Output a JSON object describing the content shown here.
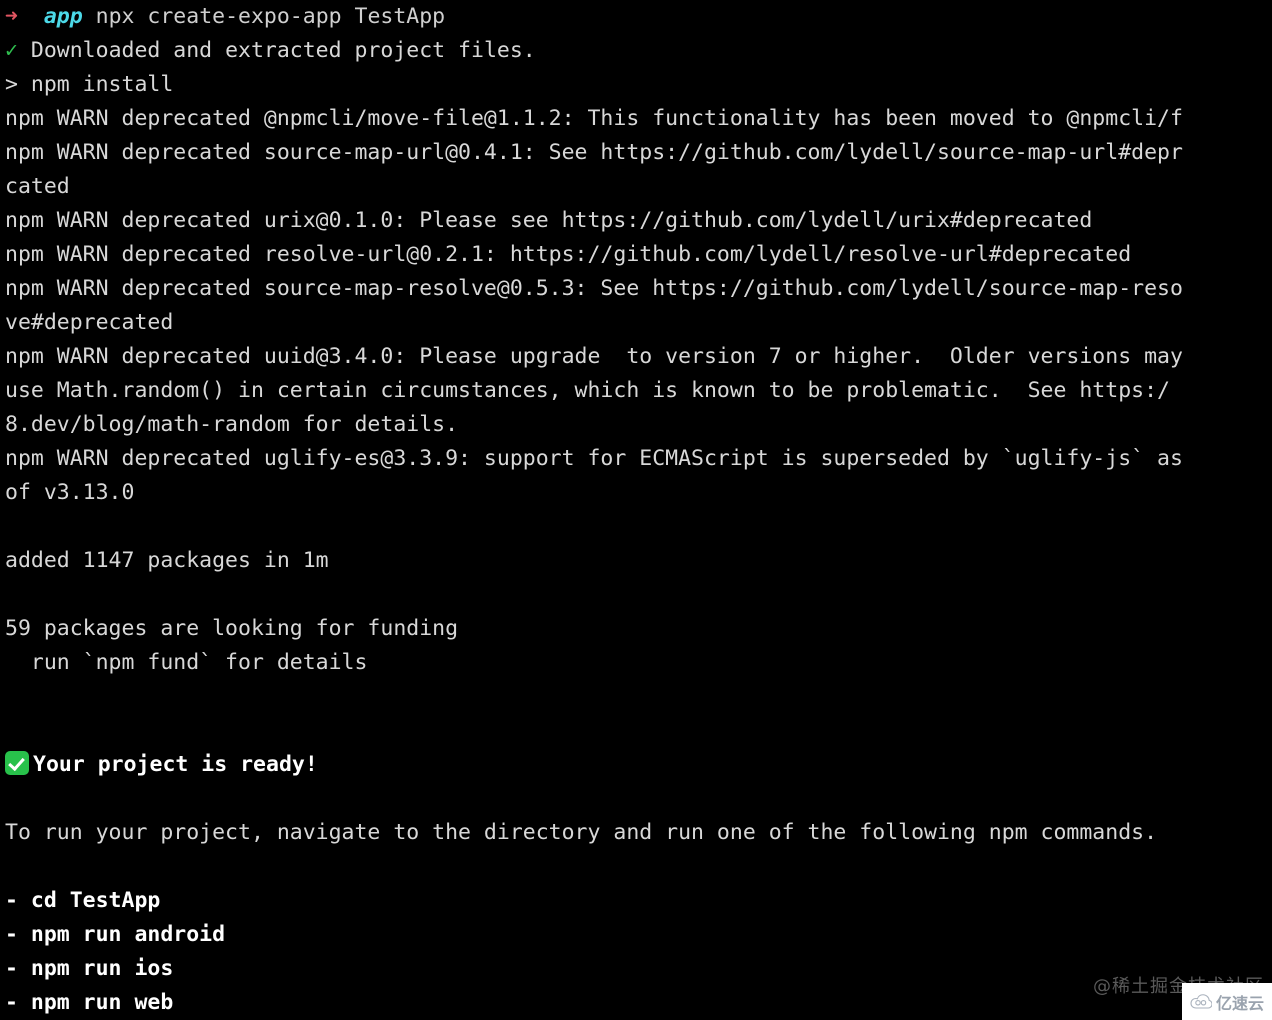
{
  "terminal": {
    "background_color": "#000000",
    "foreground_color": "#d8d8d8",
    "accent_colors": {
      "prompt_arrow": "#e05561",
      "prompt_dir": "#4cd9e8",
      "success_check": "#2fbf4f",
      "emoji_check_bg": "#28c14b"
    },
    "prompt": {
      "arrow": "➜",
      "dir": "app",
      "command": "npx create-expo-app TestApp"
    },
    "lines": [
      {
        "id": "l-downloaded",
        "check": "✓",
        "text": "Downloaded and extracted project files."
      },
      {
        "id": "l-npm-install",
        "text": "> npm install"
      },
      {
        "id": "l-warn-move-file",
        "text": "npm WARN deprecated @npmcli/move-file@1.1.2: This functionality has been moved to @npmcli/f"
      },
      {
        "id": "l-warn-source-map-url",
        "text": "npm WARN deprecated source-map-url@0.4.1: See https://github.com/lydell/source-map-url#depr"
      },
      {
        "id": "l-warn-source-map-url-wrap",
        "text": "cated"
      },
      {
        "id": "l-warn-urix",
        "text": "npm WARN deprecated urix@0.1.0: Please see https://github.com/lydell/urix#deprecated"
      },
      {
        "id": "l-warn-resolve-url",
        "text": "npm WARN deprecated resolve-url@0.2.1: https://github.com/lydell/resolve-url#deprecated"
      },
      {
        "id": "l-warn-source-map-resolve",
        "text": "npm WARN deprecated source-map-resolve@0.5.3: See https://github.com/lydell/source-map-reso"
      },
      {
        "id": "l-warn-source-map-resolve-wrap",
        "text": "ve#deprecated"
      },
      {
        "id": "l-warn-uuid",
        "text": "npm WARN deprecated uuid@3.4.0: Please upgrade  to version 7 or higher.  Older versions may"
      },
      {
        "id": "l-warn-uuid-wrap1",
        "text": "use Math.random() in certain circumstances, which is known to be problematic.  See https:/"
      },
      {
        "id": "l-warn-uuid-wrap2",
        "text": "8.dev/blog/math-random for details."
      },
      {
        "id": "l-warn-uglify",
        "text": "npm WARN deprecated uglify-es@3.3.9: support for ECMAScript is superseded by `uglify-js` as"
      },
      {
        "id": "l-warn-uglify-wrap",
        "text": "of v3.13.0"
      },
      {
        "id": "l-blank-1",
        "text": ""
      },
      {
        "id": "l-added",
        "text": "added 1147 packages in 1m"
      },
      {
        "id": "l-blank-2",
        "text": ""
      },
      {
        "id": "l-funding",
        "text": "59 packages are looking for funding"
      },
      {
        "id": "l-funding-run",
        "text": "  run `npm fund` for details"
      },
      {
        "id": "l-blank-3",
        "text": ""
      },
      {
        "id": "l-blank-4",
        "text": ""
      },
      {
        "id": "l-ready",
        "emoji": "✅",
        "text": "Your project is ready!",
        "bold": true
      },
      {
        "id": "l-blank-5",
        "text": ""
      },
      {
        "id": "l-torun",
        "text": "To run your project, navigate to the directory and run one of the following npm commands."
      },
      {
        "id": "l-blank-6",
        "text": ""
      },
      {
        "id": "l-cmd-cd",
        "text": "- cd TestApp",
        "bold": true
      },
      {
        "id": "l-cmd-android",
        "text": "- npm run android",
        "bold": true
      },
      {
        "id": "l-cmd-ios",
        "text": "- npm run ios",
        "bold": true
      },
      {
        "id": "l-cmd-web",
        "text": "- npm run web",
        "bold": true
      }
    ]
  },
  "watermarks": {
    "juejin": "@稀土掘金技术社区",
    "yisu": "亿速云"
  }
}
